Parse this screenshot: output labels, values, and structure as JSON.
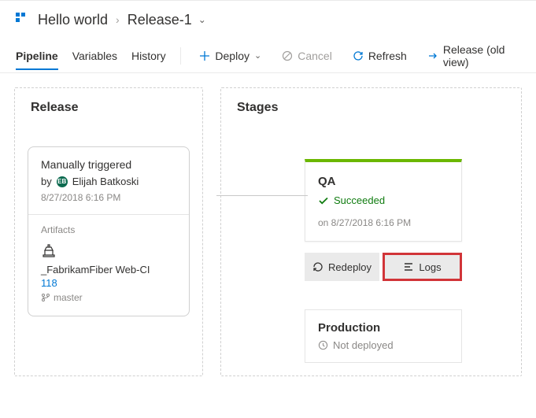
{
  "breadcrumb": {
    "root": "Hello world",
    "release": "Release-1"
  },
  "tabs": {
    "pipeline": "Pipeline",
    "variables": "Variables",
    "history": "History"
  },
  "toolbar": {
    "deploy": "Deploy",
    "cancel": "Cancel",
    "refresh": "Refresh",
    "old_view": "Release (old view)"
  },
  "panels": {
    "release": "Release",
    "stages": "Stages"
  },
  "trigger": {
    "title": "Manually triggered",
    "by_prefix": "by",
    "user_initials": "EB",
    "user": "Elijah Batkoski",
    "timestamp": "8/27/2018 6:16 PM"
  },
  "artifacts": {
    "header": "Artifacts",
    "name": "_FabrikamFiber Web-CI",
    "build": "118",
    "branch": "master"
  },
  "qa": {
    "name": "QA",
    "status": "Succeeded",
    "timestamp": "on 8/27/2018 6:16 PM",
    "redeploy": "Redeploy",
    "logs": "Logs"
  },
  "prod": {
    "name": "Production",
    "status": "Not deployed"
  }
}
